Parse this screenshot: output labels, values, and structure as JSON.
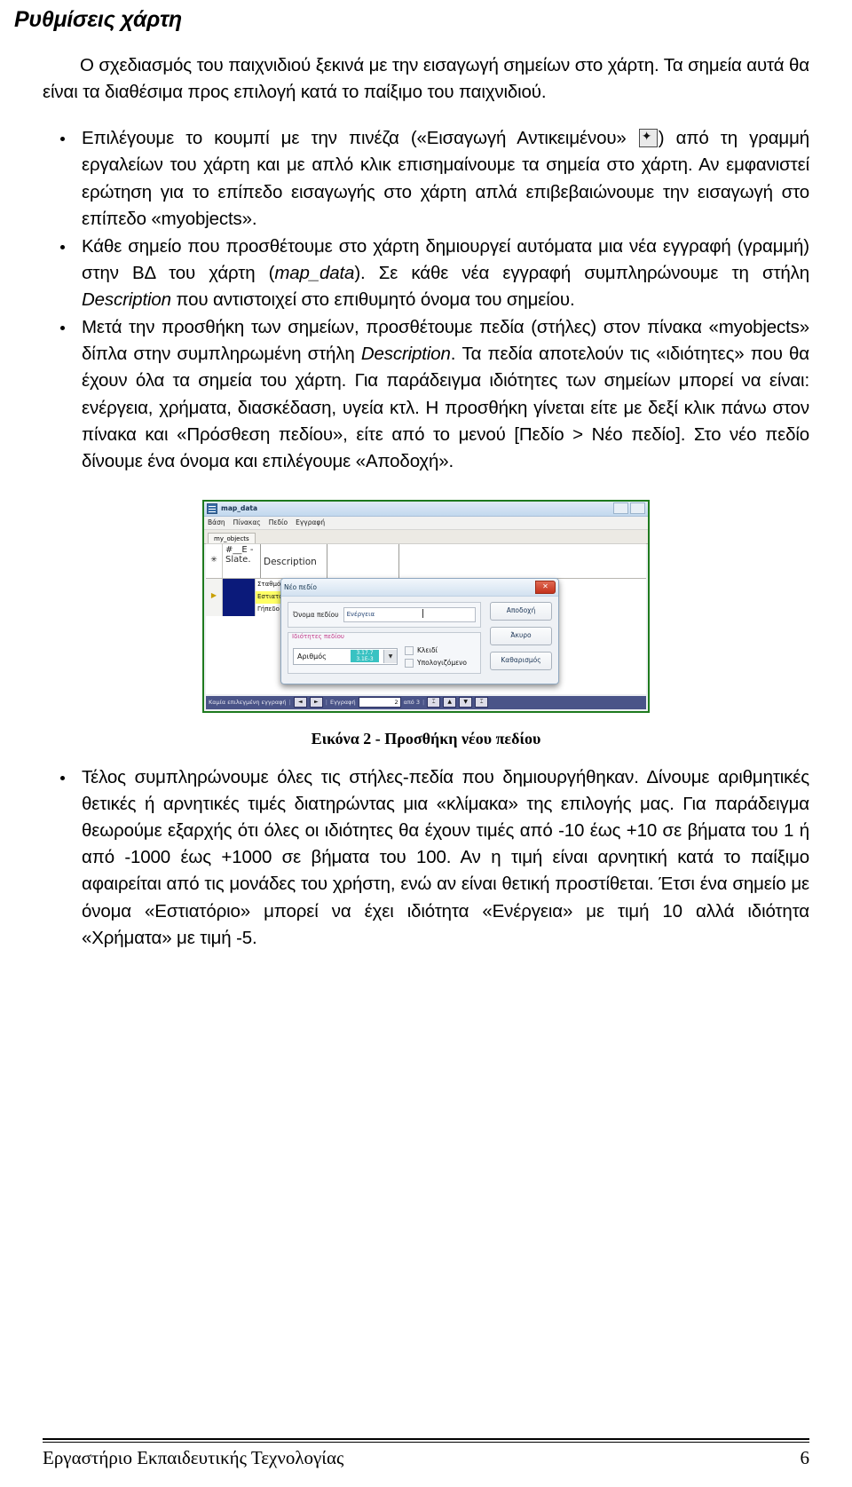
{
  "document": {
    "title": "Ρυθμίσεις χάρτη",
    "intro": "Ο σχεδιασμός του παιχνιδιού ξεκινά με την εισαγωγή σημείων στο χάρτη. Τα σημεία αυτά θα είναι τα διαθέσιμα προς επιλογή κατά το παίξιμο του παιχνιδιού.",
    "bullets": [
      {
        "part1": "Επιλέγουμε το κουμπί με την πινέζα («Εισαγωγή Αντικειμένου» ",
        "icon": "brush-icon",
        "part2": ") από τη γραμμή εργαλείων του χάρτη και με απλό κλικ επισημαίνουμε τα σημεία στο χάρτη. Αν εμφανιστεί ερώτηση για το επίπεδο εισαγωγής στο χάρτη απλά επιβεβαιώνουμε την εισαγωγή στο επίπεδο «myobjects»."
      },
      {
        "part1": "Κάθε σημείο που προσθέτουμε στο χάρτη δημιουργεί αυτόματα μια νέα εγγραφή (γραμμή) στην ΒΔ του χάρτη (",
        "italic1": "map_data",
        "part2": "). Σε κάθε νέα εγγραφή συμπληρώνουμε τη στήλη ",
        "italic2": "Description",
        "part3": " που αντιστοιχεί στο επιθυμητό όνομα του σημείου."
      },
      {
        "part1": "Μετά την προσθήκη των σημείων, προσθέτουμε πεδία (στήλες) στον πίνακα «myobjects» δίπλα στην συμπληρωμένη στήλη ",
        "italic1": "Description",
        "part2": ". Τα πεδία αποτελούν τις «ιδιότητες» που θα έχουν όλα τα σημεία του χάρτη. Για παράδειγμα ιδιότητες των σημείων μπορεί να είναι: ενέργεια, χρήματα, διασκέδαση, υγεία κτλ. Η προσθήκη γίνεται είτε με δεξί κλικ πάνω στον πίνακα και «Πρόσθεση πεδίου», είτε από το μενού [Πεδίο > Νέο πεδίο]. Στο νέο πεδίο δίνουμε ένα όνομα και επιλέγουμε «Αποδοχή»."
      },
      {
        "part1": "Τέλος συμπληρώνουμε όλες τις στήλες-πεδία που δημιουργήθηκαν. Δίνουμε αριθμητικές θετικές ή αρνητικές τιμές διατηρώντας μια «κλίμακα» της επιλογής μας. Για παράδειγμα θεωρούμε εξαρχής ότι όλες οι ιδιότητες θα έχουν τιμές από -10 έως +10 σε βήματα του 1 ή από -1000 έως +1000 σε βήματα του 100. Αν η τιμή είναι αρνητική κατά το παίξιμο αφαιρείται από τις μονάδες του χρήστη, ενώ αν είναι θετική προστίθεται. Έτσι ένα σημείο με όνομα «Εστιατόριο» μπορεί να έχει ιδιότητα «Ενέργεια» με τιμή 10 αλλά ιδιότητα «Χρήματα» με τιμή -5."
      }
    ],
    "caption": "Εικόνα 2 - Προσθήκη νέου πεδίου"
  },
  "screenshot": {
    "window_title": "map_data",
    "menu": [
      "Βάση",
      "Πίνακας",
      "Πεδίο",
      "Εγγραφή"
    ],
    "tab": "my_objects",
    "grid": {
      "header_col1": "#__E - Slate.",
      "header_col2": "Description",
      "rows": [
        {
          "description": "Σταθμός",
          "selected": false
        },
        {
          "description": "Εστιατόριο",
          "selected": true
        },
        {
          "description": "Γήπεδο",
          "selected": false
        }
      ]
    },
    "dialog": {
      "title": "Νέο πεδίο",
      "close_glyph": "✕",
      "name_label": "Όνομα πεδίου",
      "name_value": "Ενέργεια",
      "group_label": "Ιδιότητες πεδίου",
      "type_value": "Αριθμός",
      "type_ghost": "3.17.7 3.1E-3",
      "checkbox_key": "Κλειδί",
      "checkbox_calc": "Υπολογιζόμενο",
      "buttons": [
        "Αποδοχή",
        "Άκυρο",
        "Καθαρισμός"
      ]
    },
    "statusbar": {
      "message": "Καμία επιλεγμένη εγγραφή",
      "prev_glyph": "◄",
      "next_glyph": "►",
      "record_label": "Εγγραφή",
      "record_number": "2",
      "of_label": "από 3",
      "btn_first": "⌶",
      "btn_up": "▲",
      "btn_down": "▼",
      "btn_last": "⌶"
    }
  },
  "footer": {
    "left": "Εργαστήριο Εκπαιδευτικής Τεχνολογίας",
    "page": "6"
  }
}
